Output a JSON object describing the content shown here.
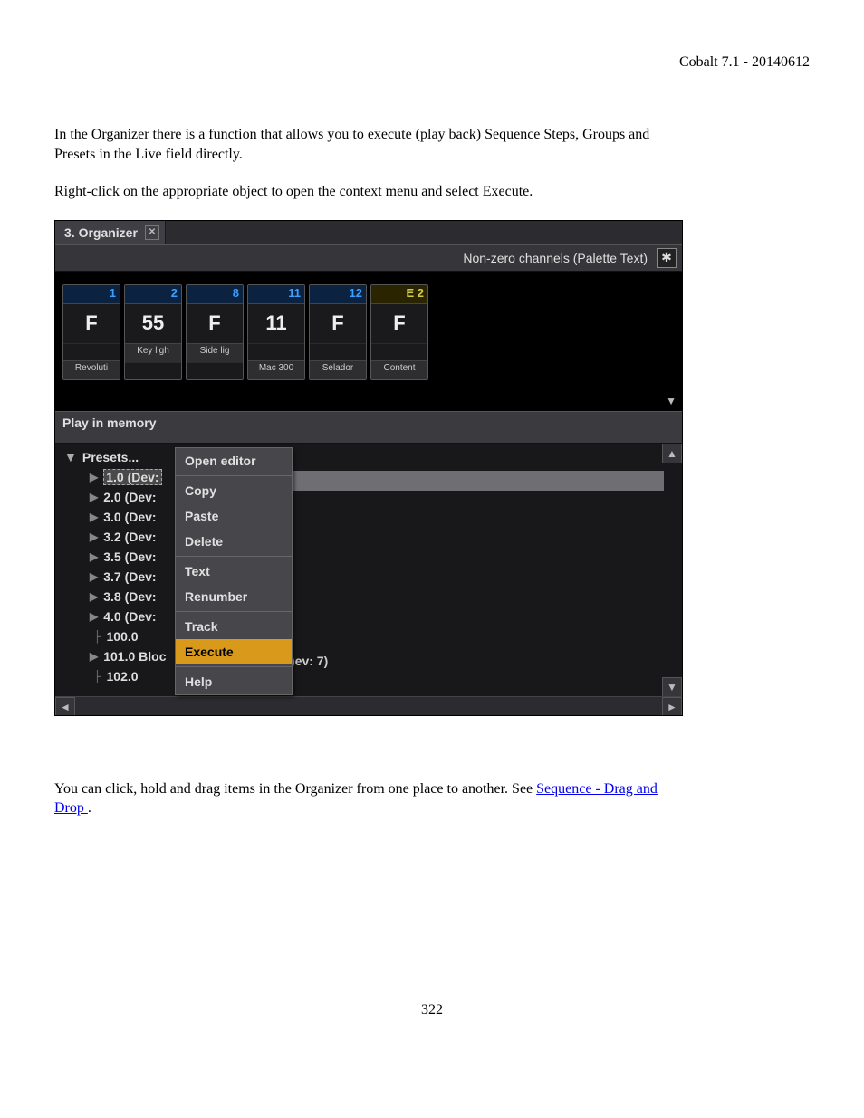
{
  "header": "Cobalt 7.1 - 20140612",
  "para1": "In the Organizer there is a function that allows you to execute (play back) Sequence Steps, Groups and Presets in the Live field directly.",
  "para2": "Right-click on the appropriate object to open the context menu and select Execute.",
  "para3_a": "You can click, hold and drag items in the Organizer from one place to another. See ",
  "para3_link": "Sequence - Drag and Drop ",
  "para3_b": ".",
  "pagenum": "322",
  "tab_title": "3. Organizer",
  "status_text": "Non-zero channels (Palette Text)",
  "cells": [
    {
      "num": "1",
      "color": "blue",
      "val": "F",
      "sub": "",
      "foot": "Revoluti"
    },
    {
      "num": "2",
      "color": "blue",
      "val": "55",
      "sub": "Key ligh",
      "foot": ""
    },
    {
      "num": "8",
      "color": "blue",
      "val": "F",
      "sub": "Side lig",
      "foot": ""
    },
    {
      "num": "11",
      "color": "blue",
      "val": "11",
      "sub": "",
      "foot": "Mac 300"
    },
    {
      "num": "12",
      "color": "blue",
      "val": "F",
      "sub": "",
      "foot": "Selador"
    },
    {
      "num": "E 2",
      "color": "yellow",
      "val": "F",
      "sub": "",
      "foot": "Content"
    }
  ],
  "section_label": "Play in memory",
  "tree_root": "Presets...",
  "tree_items": [
    {
      "label": "1.0  (Dev:",
      "sel": true,
      "type": "child"
    },
    {
      "label": "2.0  (Dev:",
      "sel": false,
      "type": "child"
    },
    {
      "label": "3.0  (Dev:",
      "sel": false,
      "type": "child"
    },
    {
      "label": "3.2  (Dev:",
      "sel": false,
      "type": "child"
    },
    {
      "label": "3.5  (Dev:",
      "sel": false,
      "type": "child"
    },
    {
      "label": "3.7  (Dev:",
      "sel": false,
      "type": "child"
    },
    {
      "label": "3.8  (Dev:",
      "sel": false,
      "type": "child"
    },
    {
      "label": "4.0  (Dev:",
      "sel": false,
      "type": "child"
    },
    {
      "label": "100.0",
      "sel": false,
      "type": "plain-branch"
    },
    {
      "label": "101.0 Bloc",
      "sel": false,
      "type": "child"
    },
    {
      "label": "102.0",
      "sel": false,
      "type": "plain-branch"
    }
  ],
  "behind_text": ")ev: 7)",
  "context_menu": [
    {
      "label": "Open editor",
      "hl": false,
      "sep_after": true
    },
    {
      "label": "Copy",
      "hl": false,
      "sep_after": false
    },
    {
      "label": "Paste",
      "hl": false,
      "sep_after": false
    },
    {
      "label": "Delete",
      "hl": false,
      "sep_after": true
    },
    {
      "label": "Text",
      "hl": false,
      "sep_after": false
    },
    {
      "label": "Renumber",
      "hl": false,
      "sep_after": true
    },
    {
      "label": "Track",
      "hl": false,
      "sep_after": false
    },
    {
      "label": "Execute",
      "hl": true,
      "sep_after": true
    },
    {
      "label": "Help",
      "hl": false,
      "sep_after": false
    }
  ]
}
